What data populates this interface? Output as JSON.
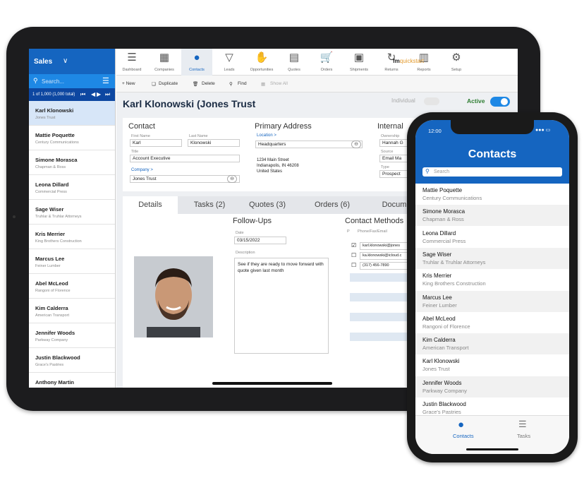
{
  "sidebar": {
    "title": "Sales",
    "search_placeholder": "Search...",
    "record_count": "1 of 1,000 (1,000 total)",
    "contacts": [
      {
        "name": "Karl Klonowski",
        "company": "Jones Trust"
      },
      {
        "name": "Mattie Poquette",
        "company": "Century Communications"
      },
      {
        "name": "Simone Morasca",
        "company": "Chapman & Ross"
      },
      {
        "name": "Leona Dillard",
        "company": "Commercial Press"
      },
      {
        "name": "Sage Wiser",
        "company": "Truhlar & Truhlar Attorneys"
      },
      {
        "name": "Kris Merrier",
        "company": "King Brothers Construction"
      },
      {
        "name": "Marcus Lee",
        "company": "Feiner Lumber"
      },
      {
        "name": "Abel McLeod",
        "company": "Rangoni of Florence"
      },
      {
        "name": "Kim Calderra",
        "company": "American Transport"
      },
      {
        "name": "Jennifer Woods",
        "company": "Parkway Company"
      },
      {
        "name": "Justin Blackwood",
        "company": "Grace's Pastries"
      },
      {
        "name": "Anthony Martin",
        "company": ""
      }
    ]
  },
  "nav": {
    "items": [
      "Dashboard",
      "Companies",
      "Contacts",
      "Leads",
      "Opportunities",
      "Quotes",
      "Orders",
      "Shipments",
      "Returns",
      "Reports",
      "Setup"
    ],
    "active": "Contacts",
    "logo_fm": "fm",
    "logo_rest": "quickstart"
  },
  "actions": {
    "new": "+ New",
    "duplicate": "Duplicate",
    "delete": "Delete",
    "find": "Find",
    "show_all": "Show All"
  },
  "record": {
    "title": "Karl Klonowski (Jones Trust",
    "individual_label": "Individual",
    "active_label": "Active",
    "contact": {
      "heading": "Contact",
      "first_name_label": "First Name",
      "first_name": "Karl",
      "last_name_label": "Last Name",
      "last_name": "Klonowski",
      "title_label": "Title",
      "title": "Account Executive",
      "company_label": "Company >",
      "company": "Jones Trust"
    },
    "address": {
      "heading": "Primary Address",
      "location_label": "Location >",
      "location": "Headquarters",
      "line1": "1234 Main Street",
      "line2": "Indianapolis, IN 46208",
      "line3": "United States"
    },
    "internal": {
      "heading": "Internal",
      "ownership_label": "Ownership",
      "ownership": "Hannah G",
      "source_label": "Source",
      "source": "Email Ma",
      "type_label": "Type",
      "type": "Prospect"
    },
    "tabs": [
      "Details",
      "Tasks (2)",
      "Quotes (3)",
      "Orders (6)",
      "Docum"
    ],
    "followups": {
      "heading": "Follow-Ups",
      "date_label": "Date",
      "date": "03/15/2022",
      "desc_label": "Description",
      "desc": "See if they are ready to move forward with quote given last month"
    },
    "methods": {
      "heading": "Contact Methods",
      "col_p": "P",
      "col_value": "Phone/Fax/Email",
      "rows": [
        "karl.klonowski@jones",
        "ka.klonowski@icloud.c",
        "(317) 456-7890"
      ]
    }
  },
  "phone": {
    "time": "12:00",
    "title": "Contacts",
    "search_placeholder": "Search",
    "contacts": [
      {
        "name": "Mattie Poquette",
        "company": "Century Communications"
      },
      {
        "name": "Simone Morasca",
        "company": "Chapman & Ross"
      },
      {
        "name": "Leona Dillard",
        "company": "Commercial Press"
      },
      {
        "name": "Sage Wiser",
        "company": "Truhlar & Truhlar Attorneys"
      },
      {
        "name": "Kris Merrier",
        "company": "King Brothers Construction"
      },
      {
        "name": "Marcus Lee",
        "company": "Feiner Lumber"
      },
      {
        "name": "Abel McLeod",
        "company": "Rangoni of Florence"
      },
      {
        "name": "Kim Calderra",
        "company": "American Transport"
      },
      {
        "name": "Karl Klonowski",
        "company": "Jones Trust"
      },
      {
        "name": "Jennifer Woods",
        "company": "Parkway Company"
      },
      {
        "name": "Justin Blackwood",
        "company": "Grace's Pastries"
      }
    ],
    "tabs": [
      "Contacts",
      "Tasks"
    ],
    "colors": {
      "accent": "#1565c0",
      "active_toggle": "#1e88e5",
      "active_text": "#2e7d32"
    }
  }
}
